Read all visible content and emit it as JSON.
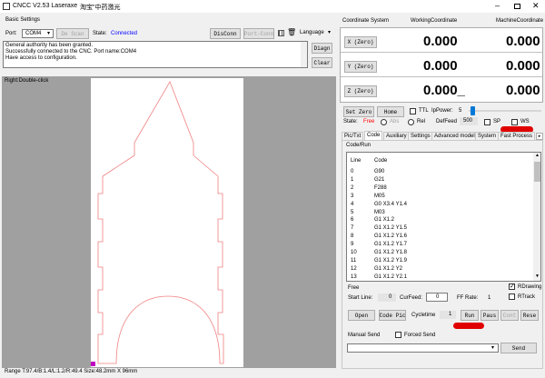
{
  "window": {
    "title": "CNCC V2.53  Laseraxe",
    "subtitle": "淘宝\"中药激光"
  },
  "basic_settings": {
    "title": "Basic Settings",
    "port_label": "Port:",
    "port_value": "COM4",
    "de_scan": "De Scan",
    "state_label": "State:",
    "state_value": "Connected",
    "disconn": "DisConn",
    "port_conn": "Port-Conn",
    "language": "Language"
  },
  "log": {
    "lines": [
      "General authority has been granted.",
      "Successfully connected to the CNC. Port name:COM4",
      "Have access to configuration."
    ],
    "diagn": "Diagn",
    "clear": "Clear"
  },
  "canvas": {
    "hint": "Right:Double-click",
    "status": "Range T:97.4/B:1.4/L:1.2/R:49.4  Size:48.2mm X 96mm"
  },
  "coords": {
    "system_label": "Coordinate System",
    "working_label": "WorkingCoordinate",
    "machine_label": "MachineCoordinate",
    "rows": [
      {
        "btn": "X (Zero)",
        "working": "0.000",
        "machine": "0.000"
      },
      {
        "btn": "Y (Zero)",
        "working": "0.000",
        "machine": "0.000"
      },
      {
        "btn": "Z (Zero)",
        "working": "0.000_",
        "machine": "0.000"
      }
    ]
  },
  "controls": {
    "set_zero": "Set Zero",
    "home": "Home",
    "ttl": "TTL",
    "ip_power_label": "IpPower:",
    "ip_power_value": "5",
    "ip_power_fraction": 0.03,
    "state_label": "State:",
    "state_value": "Free",
    "abs": "Abs",
    "rel": "Rel",
    "def_feed_label": "DefFeed",
    "def_feed_value": "500",
    "sp": "SP",
    "ws": "WS"
  },
  "tabs": [
    "Pic/Txt",
    "Code",
    "Auxiliary",
    "Settings",
    "Advanced model",
    "System",
    "Fast Process"
  ],
  "code_panel": {
    "title": "Code/Run",
    "col_line": "Line",
    "col_code": "Code",
    "rows": [
      {
        "line": "0",
        "code": "G90"
      },
      {
        "line": "1",
        "code": "G21"
      },
      {
        "line": "2",
        "code": "F288"
      },
      {
        "line": "3",
        "code": "M05"
      },
      {
        "line": "4",
        "code": "G0 X3.4 Y1.4"
      },
      {
        "line": "5",
        "code": "M03"
      },
      {
        "line": "6",
        "code": "G1 X1.2"
      },
      {
        "line": "7",
        "code": "G1 X1.2 Y1.5"
      },
      {
        "line": "8",
        "code": "G1 X1.2 Y1.6"
      },
      {
        "line": "9",
        "code": "G1 X1.2 Y1.7"
      },
      {
        "line": "10",
        "code": "G1 X1.2 Y1.8"
      },
      {
        "line": "11",
        "code": "G1 X1.2 Y1.9"
      },
      {
        "line": "12",
        "code": "G1 X1.2 Y2"
      },
      {
        "line": "13",
        "code": "G1 X1.2 Y2.1"
      }
    ]
  },
  "run": {
    "status": "Free",
    "rdrawing": "RDrawing",
    "rtrack": "RTrack",
    "start_line_label": "Start Line:",
    "start_line_value": "0",
    "cur_feed_label": "CurFeed:",
    "cur_feed_value": "0",
    "ff_rate_label": "FF Rate:",
    "ff_rate_value": "1",
    "open": "Open",
    "code_pic": "Code Pic",
    "cycletime_label": "Cycletime",
    "cycletime_value": "1",
    "run": "Run",
    "paus": "Paus",
    "cont": "Cont",
    "rese": "Rese"
  },
  "manual": {
    "title": "Manual Send",
    "forced": "Forced Send",
    "send": "Send"
  },
  "colors": {
    "accent": "#0078d7",
    "connected": "#0000ff",
    "state_free": "#ff0000",
    "mark": "#e00000",
    "outline": "#f08080"
  }
}
